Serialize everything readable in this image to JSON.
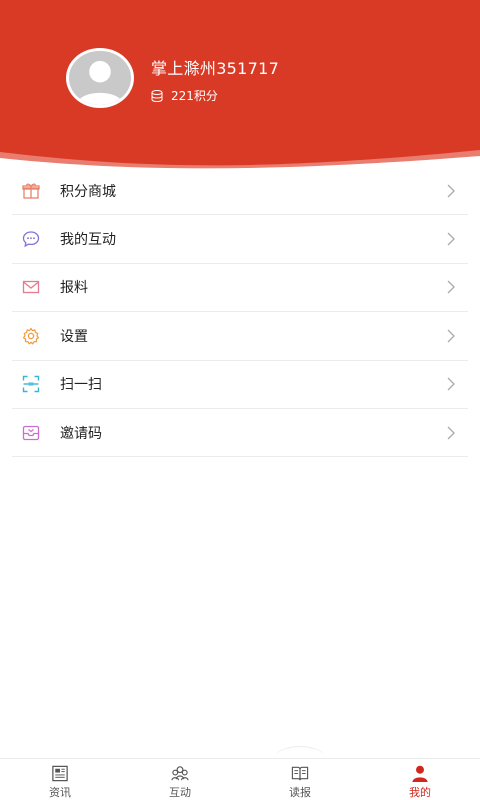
{
  "profile": {
    "username": "掌上滁州351717",
    "points": "221积分"
  },
  "colors": {
    "brand": "#d93a26",
    "active_tab": "#d0281d"
  },
  "menu": [
    {
      "label": "积分商城",
      "icon": "gift-icon"
    },
    {
      "label": "我的互动",
      "icon": "chat-bubble-icon"
    },
    {
      "label": "报料",
      "icon": "mail-icon"
    },
    {
      "label": "设置",
      "icon": "gear-icon"
    },
    {
      "label": "扫一扫",
      "icon": "scan-icon"
    },
    {
      "label": "邀请码",
      "icon": "inbox-icon"
    }
  ],
  "tabs": [
    {
      "label": "资讯",
      "icon": "newspaper-icon",
      "active": false
    },
    {
      "label": "互动",
      "icon": "people-icon",
      "active": false
    },
    {
      "label": "读报",
      "icon": "book-icon",
      "active": false
    },
    {
      "label": "我的",
      "icon": "user-icon",
      "active": true
    }
  ]
}
